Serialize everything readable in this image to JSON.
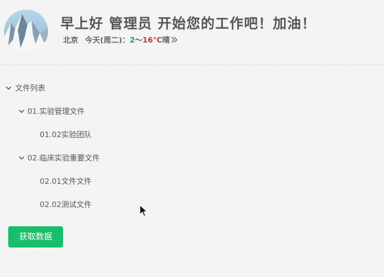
{
  "header": {
    "avatar": "user-avatar",
    "greeting": "早上好 管理员 开始您的工作吧！加油！",
    "weather": {
      "city": "北京",
      "day": "今天(周二)：",
      "temp_low": "2",
      "range_sep": "～",
      "temp_high": "16°C",
      "condition": "晴",
      "more_icon": "double-chevron-right-icon"
    }
  },
  "tree": {
    "nodes": [
      {
        "label": "文件列表",
        "level": 0,
        "expanded": true
      },
      {
        "label": "01.实验管理文件",
        "level": 1,
        "expanded": true
      },
      {
        "label": "01.02实验团队",
        "level": 2
      },
      {
        "label": "02.临床实验重要文件",
        "level": 1,
        "expanded": true
      },
      {
        "label": "02.01文件文件",
        "level": 2
      },
      {
        "label": "02.02测试文件",
        "level": 2
      }
    ]
  },
  "actions": {
    "fetch_label": "获取数据"
  },
  "colors": {
    "button": "#19be6b",
    "temp_low": "#1a9a5b",
    "temp_high": "#c0392b"
  }
}
